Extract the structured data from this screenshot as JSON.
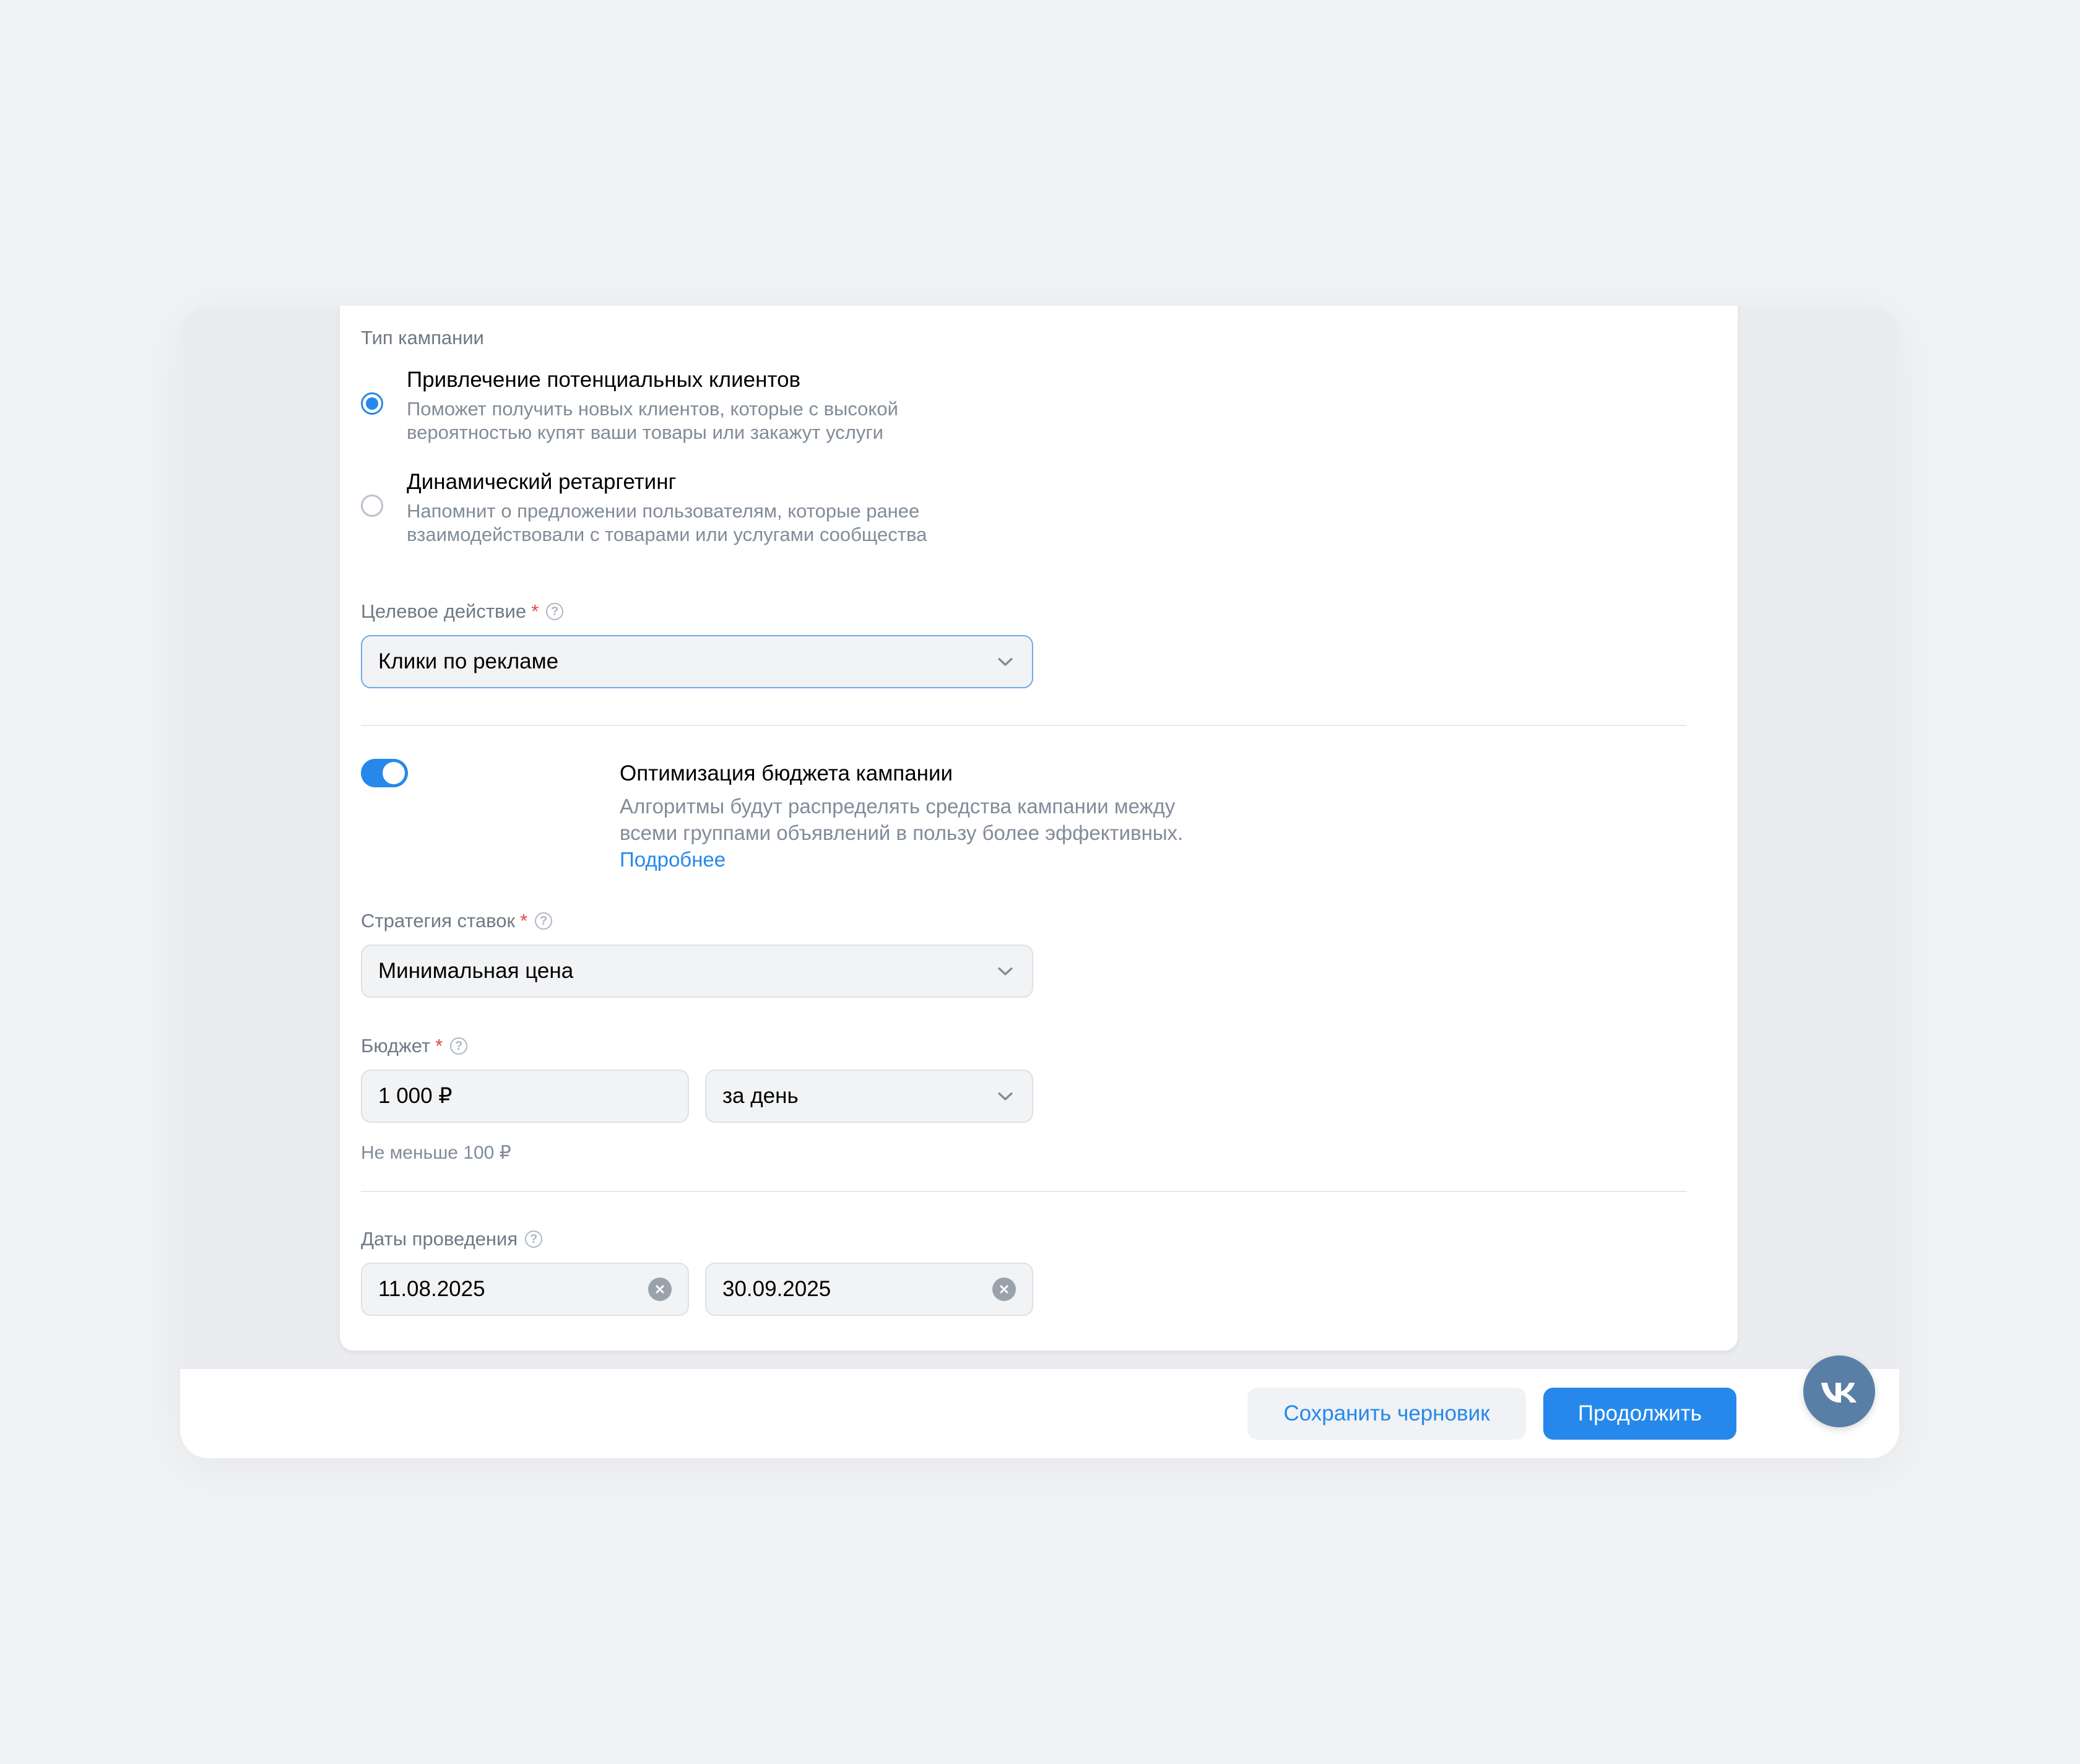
{
  "campaign_type": {
    "label": "Тип кампании",
    "options": [
      {
        "title": "Привлечение потенциальных клиентов",
        "description": "Поможет получить новых клиентов, которые с высокой вероятностью купят ваши товары или закажут услуги",
        "selected": true
      },
      {
        "title": "Динамический ретаргетинг",
        "description": "Напомнит о предложении пользователям, которые ранее взаимодействовали с товарами или услугами сообщества",
        "selected": false
      }
    ]
  },
  "target_action": {
    "label": "Целевое действие",
    "required_mark": "*",
    "value": "Клики по рекламе"
  },
  "budget_optimization": {
    "title": "Оптимизация бюджета кампании",
    "enabled": true,
    "description": "Алгоритмы будут распределять средства кампании между всеми группами объявлений в пользу более эффективных.",
    "link_label": "Подробнее"
  },
  "bid_strategy": {
    "label": "Стратегия ставок",
    "required_mark": "*",
    "value": "Минимальная цена"
  },
  "budget": {
    "label": "Бюджет",
    "required_mark": "*",
    "amount": "1 000 ₽",
    "period": "за день",
    "hint": "Не меньше 100 ₽"
  },
  "dates": {
    "label": "Даты проведения",
    "start": "11.08.2025",
    "end": "30.09.2025"
  },
  "footer": {
    "save_draft_label": "Сохранить черновик",
    "continue_label": "Продолжить"
  },
  "fab": {
    "icon": "vk-logo-icon",
    "label": "VK"
  },
  "colors": {
    "accent": "#2688eb",
    "background": "#f1f2f4",
    "fab": "#5a7fa6"
  }
}
